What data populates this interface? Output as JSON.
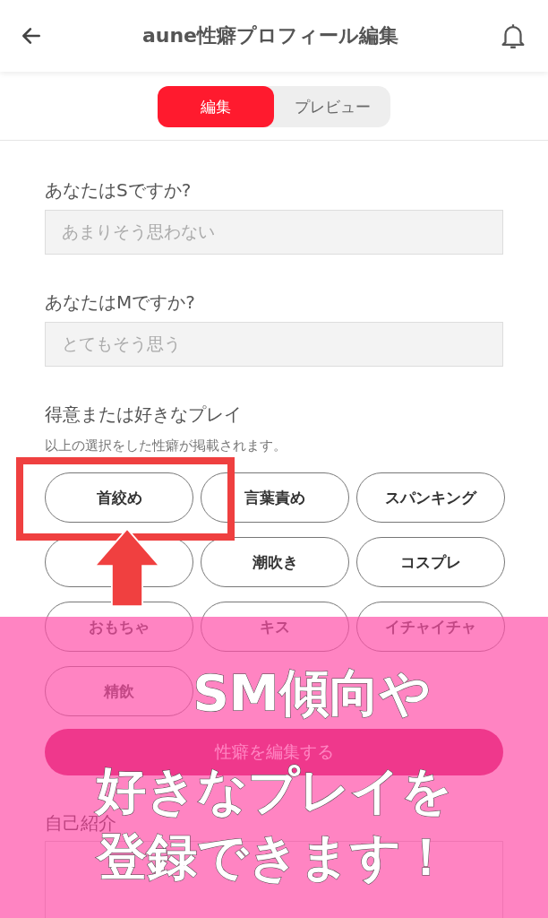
{
  "header": {
    "title": "aune性癖プロフィール編集"
  },
  "tabs": [
    {
      "label": "編集",
      "selected": true
    },
    {
      "label": "プレビュー",
      "selected": false
    }
  ],
  "questions": [
    {
      "label": "あなたはSですか?",
      "value": "あまりそう思わない"
    },
    {
      "label": "あなたはMですか?",
      "value": "とてもそう思う"
    }
  ],
  "plays": {
    "label": "得意または好きなプレイ",
    "hint": "以上の選択をした性癖が掲載されます。",
    "chips": [
      {
        "kind": "text",
        "label": "首絞め"
      },
      {
        "kind": "text",
        "label": "言葉責め"
      },
      {
        "kind": "text",
        "label": "スパンキング"
      },
      {
        "kind": "covered"
      },
      {
        "kind": "text",
        "label": "潮吹き"
      },
      {
        "kind": "text",
        "label": "コスプレ"
      },
      {
        "kind": "text",
        "label": "おもちゃ"
      },
      {
        "kind": "text",
        "label": "キス"
      },
      {
        "kind": "text",
        "label": "イチャイチャ"
      },
      {
        "kind": "text",
        "label": "精飲"
      }
    ],
    "button": "性癖を編集する"
  },
  "intro": {
    "label": "自己紹介"
  },
  "promo": {
    "lines": [
      "SM傾向や",
      "好きなプレイを",
      "登録できます！"
    ]
  }
}
